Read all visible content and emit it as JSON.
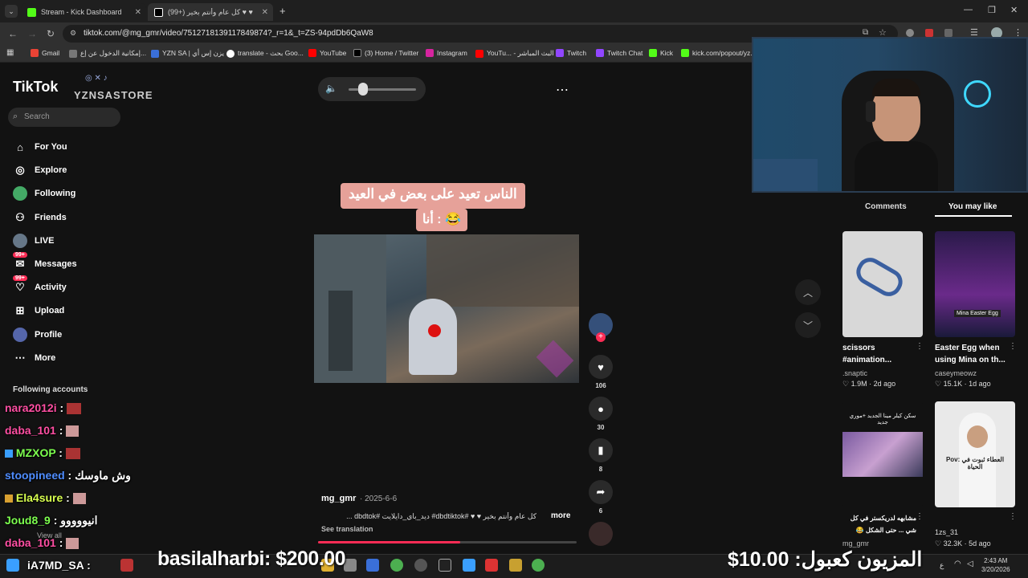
{
  "browser": {
    "tabs": [
      {
        "label": "Stream - Kick Dashboard",
        "favicon_color": "#53fc18"
      },
      {
        "label": "(99+) كل عام وأنتم بخير ♥ ♥",
        "favicon_color": "#ffffff"
      }
    ],
    "url": "tiktok.com/@mg_gmr/video/7512718139117849874?_r=1&_t=ZS-94pdDb6QaW8",
    "bookmarks": [
      "Gmail",
      "إمكانية الدخول عن إع...",
      "YZN SA | يزن إس أي",
      "translate - بحث Goo...",
      "YouTube",
      "(3) Home / Twitter",
      "Instagram",
      "YouTu... - البث المباشر",
      "Twitch",
      "Twitch Chat",
      "Kick",
      "kick.com/popout/yz..."
    ]
  },
  "tiktok": {
    "logo": "TikTok",
    "overlay_brand": "YZNSASTORE",
    "search_placeholder": "Search",
    "nav": [
      {
        "label": "For You",
        "icon": "home-icon"
      },
      {
        "label": "Explore",
        "icon": "compass-icon"
      },
      {
        "label": "Following",
        "icon": "avatar-icon"
      },
      {
        "label": "Friends",
        "icon": "friends-icon"
      },
      {
        "label": "LIVE",
        "icon": "live-icon"
      },
      {
        "label": "Messages",
        "icon": "messages-icon",
        "badge": "99+"
      },
      {
        "label": "Activity",
        "icon": "activity-icon",
        "badge": "99+"
      },
      {
        "label": "Upload",
        "icon": "upload-icon"
      },
      {
        "label": "Profile",
        "icon": "profile-icon"
      },
      {
        "label": "More",
        "icon": "more-icon"
      }
    ],
    "following_heading": "Following accounts",
    "see_all": "View all",
    "video": {
      "caption_line1": "الناس تعيد على بعض في العيد",
      "caption_line2": "أنا : 😂",
      "author": "mg_gmr",
      "date": "· 2025-6-6",
      "description": "كل عام وأنتم بخير ♥ ♥ #dbdtiktok# ديد_باي_دايلايت #dbdtok ...",
      "more": "more",
      "see_translation": "See translation",
      "likes": "106",
      "comments": "30",
      "saves": "8",
      "shares": "6",
      "progress": 0.55
    },
    "right_tabs": {
      "comments": "Comments",
      "you_may_like": "You may like"
    },
    "cards": [
      {
        "title": "scissors #animation...",
        "user": ".snaptic",
        "likes": "1.9M",
        "age": "2d ago"
      },
      {
        "title": "Easter Egg when using Mina on th...",
        "user": "caseymeowz",
        "likes": "15.1K",
        "age": "1d ago",
        "thumb_text": "Mina Easter Egg"
      },
      {
        "title": "مشابهه لدريكستر في كل شي ... حتى الشكل 😂",
        "user": "mg_gmr",
        "thumb_text": "سكن كيلر مينا الجديد +موري جديد"
      },
      {
        "title": "",
        "user": "1zs_31",
        "likes": "32.3K",
        "age": "5d ago",
        "thumb_text": "Pov: العطاء ثبوت في الحياة"
      }
    ]
  },
  "chat": [
    {
      "user": "nara2012i",
      "sep": " :",
      "msg": "",
      "color": "#ff4fa3"
    },
    {
      "user": "daba_101",
      "sep": " :",
      "msg": "",
      "color": "#ff4fa3"
    },
    {
      "user": "MZXOP",
      "sep": " :",
      "msg": "",
      "color": "#7dff4f"
    },
    {
      "user": "stoopineed",
      "sep": " :",
      "msg": "وش ماوسك",
      "color": "#4f8dff"
    },
    {
      "user": "Ela4sure",
      "sep": " :",
      "msg": "",
      "color": "#d8ff4f"
    },
    {
      "user": "Joud8_9",
      "sep": " :",
      "msg": "انيووووو",
      "color": "#7dff4f"
    },
    {
      "user": "daba_101",
      "sep": " :",
      "msg": "",
      "color": "#ff4fa3"
    },
    {
      "user": "iA7MD_SA",
      "sep": " :",
      "msg": "",
      "color": "#ffffff"
    }
  ],
  "donations": {
    "left": "basilalharbi: $200.00",
    "right": "المزيون كعبول: 10.00$"
  },
  "taskbar": {
    "time": "2:43 AM",
    "date": "3/20/2026",
    "lang": "ع"
  },
  "colors": {
    "accent": "#fe2c55",
    "page_bg": "#121212"
  }
}
